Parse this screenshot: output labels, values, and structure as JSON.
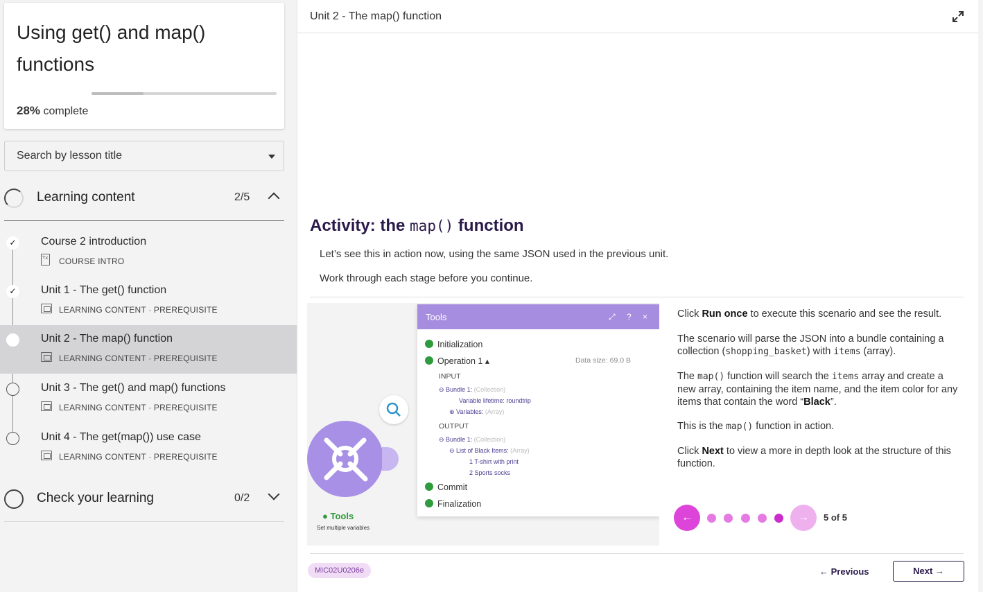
{
  "sidebar": {
    "course_title": "Using get() and map() functions",
    "progress_percent": 28,
    "progress_number": "28%",
    "progress_suffix": " complete",
    "search_placeholder": "Search by lesson title",
    "sections": [
      {
        "title": "Learning content",
        "count": "2/5",
        "expanded": true,
        "lessons": [
          {
            "title": "Course 2 introduction",
            "meta": "COURSE INTRO",
            "status": "done"
          },
          {
            "title": "Unit 1 - The get() function",
            "meta": "LEARNING CONTENT · PREREQUISITE",
            "status": "done"
          },
          {
            "title": "Unit 2 - The map() function",
            "meta": "LEARNING CONTENT · PREREQUISITE",
            "status": "current"
          },
          {
            "title": "Unit 3 - The get() and map() functions",
            "meta": "LEARNING CONTENT · PREREQUISITE",
            "status": "todo"
          },
          {
            "title": "Unit 4 - The get(map()) use case",
            "meta": "LEARNING CONTENT · PREREQUISITE",
            "status": "todo"
          }
        ]
      },
      {
        "title": "Check your learning",
        "count": "0/2",
        "expanded": false
      }
    ]
  },
  "main": {
    "unit_title": "Unit 2 - The map() function",
    "activity": {
      "prefix": "Activity: the ",
      "code": "map()",
      "suffix": " function"
    },
    "intro": [
      "Let’s see this in action now, using the same JSON used in the previous unit.",
      "Work through each stage before you continue."
    ],
    "screenshot": {
      "panel_title": "Tools",
      "panel_controls": [
        "⤢",
        "?",
        "×"
      ],
      "initialization": "Initialization",
      "operation": "Operation 1",
      "data_size": "Data size: 69.0 B",
      "input_label": "INPUT",
      "bundle_in": "Bundle 1:",
      "bundle_in_type": "(Collection)",
      "var_lifetime": "Variable lifetime: roundtrip",
      "variables": "Variables:",
      "variables_type": "(Array)",
      "output_label": "OUTPUT",
      "bundle_out": "Bundle 1:",
      "bundle_out_type": "(Collection)",
      "list_label": "List of Black Items:",
      "list_type": "(Array)",
      "item1": "1  T-shirt with print",
      "item2": "2  Sports socks",
      "commit": "Commit",
      "finalization": "Finalization",
      "module_name": "Tools",
      "module_desc": "Set multiple variables"
    },
    "steps": {
      "p1_a": "Click ",
      "p1_b": "Run once",
      "p1_c": " to execute this scenario and see the result.",
      "p2_a": "The scenario will parse the JSON into a bundle containing a collection (",
      "p2_code1": "shopping_basket",
      "p2_b": ") with ",
      "p2_code2": "items",
      "p2_c": " (array).",
      "p3_a": "The ",
      "p3_code1": "map()",
      "p3_b": " function will search the ",
      "p3_code2": "items",
      "p3_c": " array and create a new array, containing the item name, and the item color for any items that contain the word “",
      "p3_bold": "Black",
      "p3_d": "”.",
      "p4_a": "This is the ",
      "p4_code": "map()",
      "p4_b": " function in action.",
      "p5_a": "Click ",
      "p5_b": "Next",
      "p5_c": " to view a more in depth look at the structure of this function."
    },
    "pager": {
      "prev": "←",
      "next": "→",
      "count": "5 of 5",
      "current": 5,
      "total": 5
    },
    "footer": {
      "code": "MIC02U0206e",
      "previous": "← Previous",
      "next": "Next →"
    }
  },
  "colors": {
    "accent": "#dd44d9",
    "title": "#2a1a4a",
    "purple": "#a78de0",
    "success": "#2e9b3c"
  }
}
